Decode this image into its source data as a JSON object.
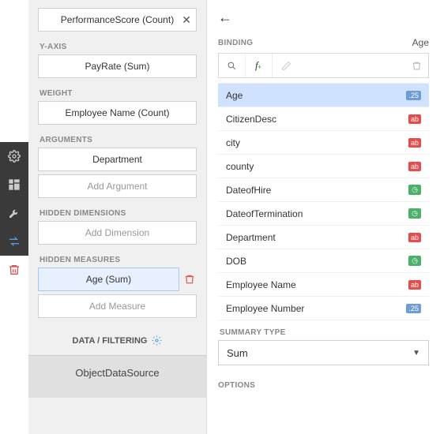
{
  "toolbar": {
    "gear": "gear-icon",
    "layout": "layout-icon",
    "wrench": "wrench-icon",
    "swap": "swap-icon",
    "trash": "trash-icon"
  },
  "left": {
    "xaxis_field": "PerformanceScore (Count)",
    "yaxis_label": "Y-AXIS",
    "yaxis_field": "PayRate (Sum)",
    "weight_label": "WEIGHT",
    "weight_field": "Employee Name (Count)",
    "arguments_label": "ARGUMENTS",
    "arguments": [
      "Department"
    ],
    "add_argument": "Add Argument",
    "hidden_dim_label": "HIDDEN DIMENSIONS",
    "add_dimension": "Add Dimension",
    "hidden_meas_label": "HIDDEN MEASURES",
    "hidden_measures": [
      "Age (Sum)"
    ],
    "add_measure": "Add Measure",
    "data_filtering": "DATA / FILTERING",
    "datasource": "ObjectDataSource"
  },
  "right": {
    "binding_label": "BINDING",
    "binding_value": "Age",
    "fields": [
      {
        "name": "Age",
        "type": "num",
        "tag": ".25",
        "selected": true
      },
      {
        "name": "CitizenDesc",
        "type": "ab",
        "tag": "ab",
        "selected": false
      },
      {
        "name": "city",
        "type": "ab",
        "tag": "ab",
        "selected": false
      },
      {
        "name": "county",
        "type": "ab",
        "tag": "ab",
        "selected": false
      },
      {
        "name": "DateofHire",
        "type": "clk",
        "tag": "◷",
        "selected": false
      },
      {
        "name": "DateofTermination",
        "type": "clk",
        "tag": "◷",
        "selected": false
      },
      {
        "name": "Department",
        "type": "ab",
        "tag": "ab",
        "selected": false
      },
      {
        "name": "DOB",
        "type": "clk",
        "tag": "◷",
        "selected": false
      },
      {
        "name": "Employee Name",
        "type": "ab",
        "tag": "ab",
        "selected": false
      },
      {
        "name": "Employee Number",
        "type": "num",
        "tag": ".25",
        "selected": false
      }
    ],
    "summary_label": "SUMMARY TYPE",
    "summary_value": "Sum",
    "options_label": "OPTIONS"
  }
}
